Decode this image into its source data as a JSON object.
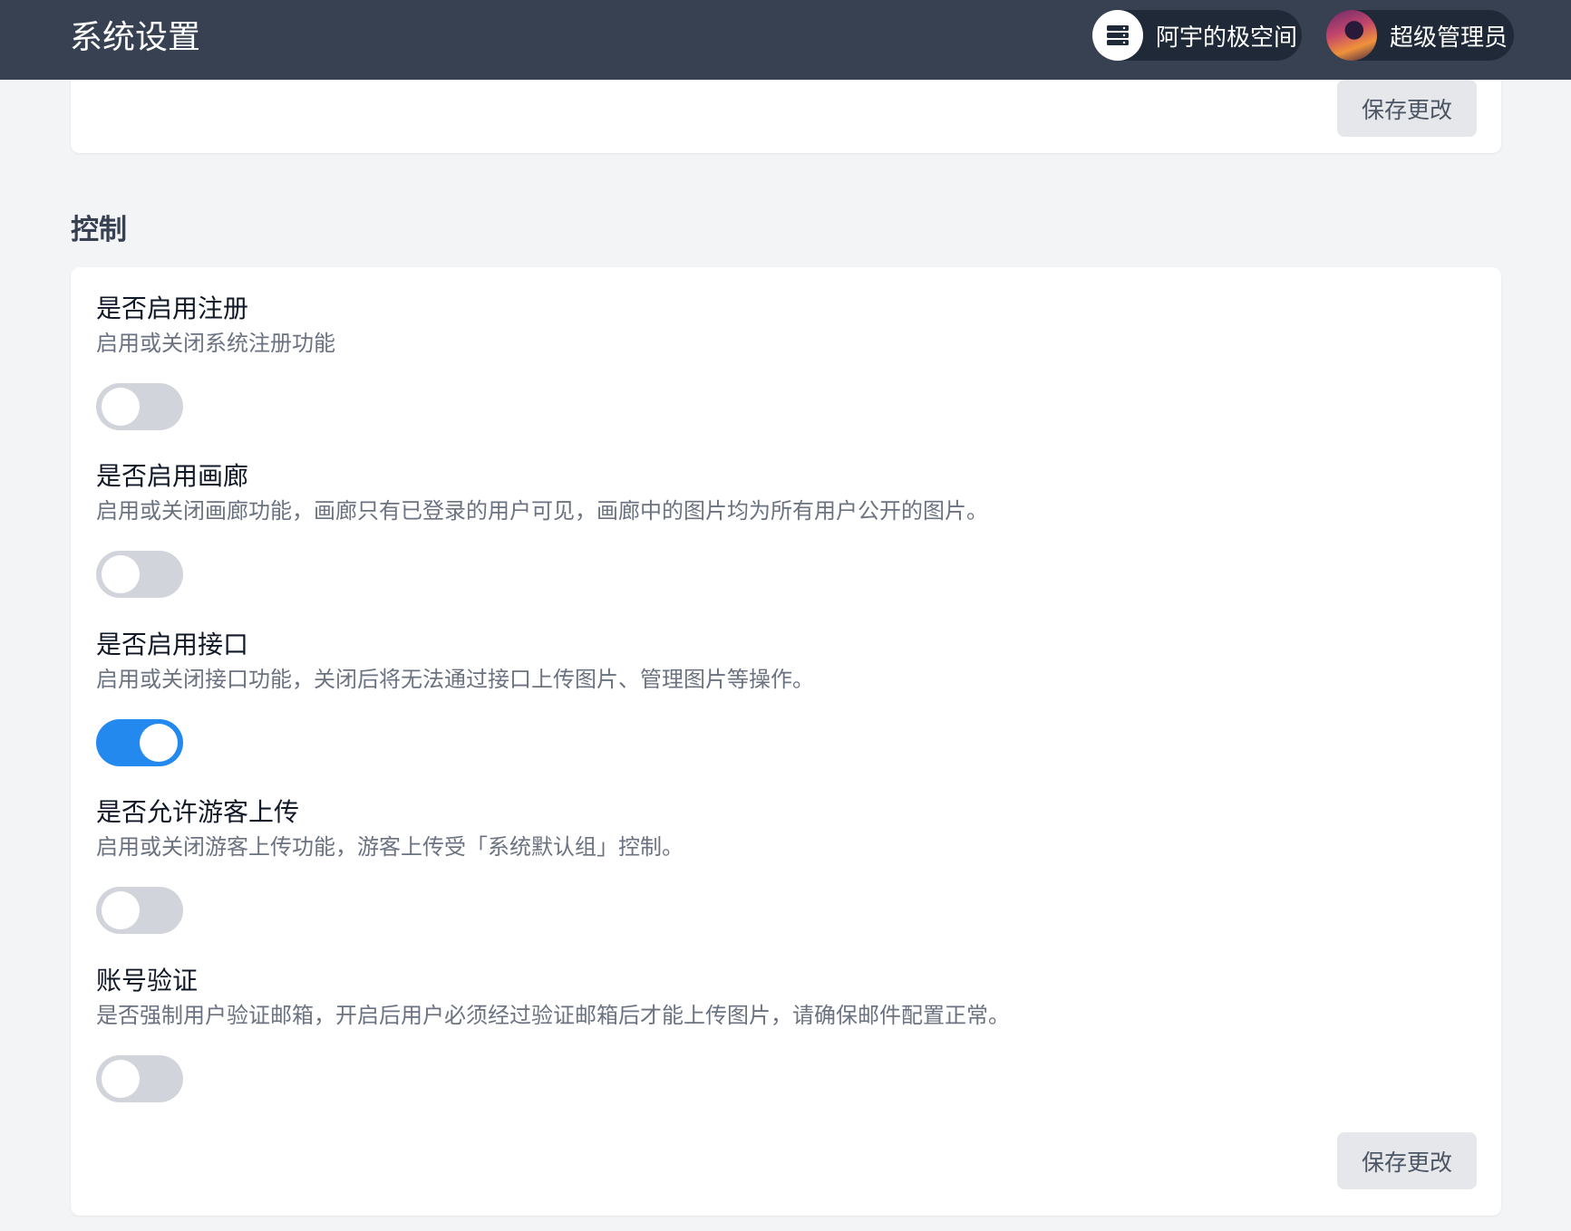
{
  "header": {
    "title": "系统设置",
    "server_name": "阿宇的极空间",
    "server_icon": "server-icon",
    "user_name": "超级管理员"
  },
  "top_card": {
    "save_label": "保存更改"
  },
  "control": {
    "section_title": "控制",
    "settings": [
      {
        "label": "是否启用注册",
        "desc": "启用或关闭系统注册功能",
        "enabled": false
      },
      {
        "label": "是否启用画廊",
        "desc": "启用或关闭画廊功能，画廊只有已登录的用户可见，画廊中的图片均为所有用户公开的图片。",
        "enabled": false
      },
      {
        "label": "是否启用接口",
        "desc": "启用或关闭接口功能，关闭后将无法通过接口上传图片、管理图片等操作。",
        "enabled": true
      },
      {
        "label": "是否允许游客上传",
        "desc": "启用或关闭游客上传功能，游客上传受「系统默认组」控制。",
        "enabled": false
      },
      {
        "label": "账号验证",
        "desc": "是否强制用户验证邮箱，开启后用户必须经过验证邮箱后才能上传图片，请确保邮件配置正常。",
        "enabled": false
      }
    ],
    "save_label": "保存更改"
  },
  "colors": {
    "accent": "#2389ee",
    "header_bg": "#374151",
    "toggle_off": "#d1d5db"
  }
}
